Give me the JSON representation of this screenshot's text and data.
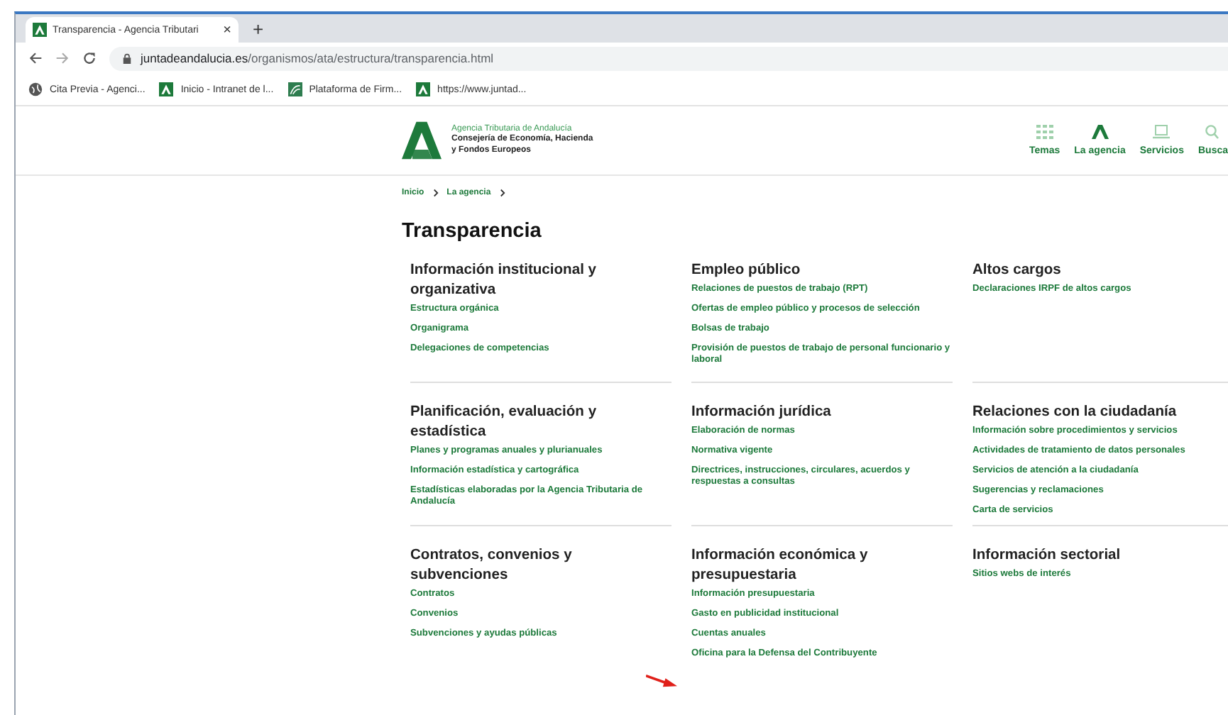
{
  "browser": {
    "tab": {
      "title": "Transparencia - Agencia Tributari",
      "close": "×"
    },
    "new_tab": "+",
    "url": {
      "domain": "juntadeandalucia.es",
      "path": "/organismos/ata/estructura/transparencia.html"
    },
    "bookmarks": [
      {
        "label": "Cita Previa - Agenci...",
        "kind": "globe"
      },
      {
        "label": "Inicio - Intranet de l...",
        "kind": "junta"
      },
      {
        "label": "Plataforma de Firm...",
        "kind": "firma"
      },
      {
        "label": "https://www.juntad...",
        "kind": "junta"
      }
    ]
  },
  "header": {
    "agency": "Agencia Tributaria de Andalucía",
    "ministry": "Consejería de Economía, Hacienda y Fondos Europeos",
    "nav": [
      {
        "label": "Temas",
        "kind": "grid",
        "selected": false
      },
      {
        "label": "La agencia",
        "kind": "logo",
        "selected": true
      },
      {
        "label": "Servicios",
        "kind": "laptop",
        "selected": false
      },
      {
        "label": "Busca",
        "kind": "search",
        "selected": false
      }
    ]
  },
  "breadcrumb": [
    "Inicio",
    "La agencia"
  ],
  "title": "Transparencia",
  "sections": [
    {
      "title": "Información institucional y organizativa",
      "links": [
        "Estructura orgánica",
        "Organigrama",
        "Delegaciones de competencias"
      ]
    },
    {
      "title": "Empleo público",
      "links": [
        "Relaciones de puestos de trabajo (RPT)",
        "Ofertas de empleo público y procesos de selección",
        "Bolsas de trabajo",
        "Provisión de puestos de trabajo de personal funcionario y laboral"
      ]
    },
    {
      "title": "Altos cargos",
      "links": [
        "Declaraciones IRPF de altos cargos"
      ]
    },
    {
      "title": "Planificación, evaluación y estadística",
      "links": [
        "Planes y programas anuales y plurianuales",
        "Información estadística y cartográfica",
        "Estadísticas elaboradas por la Agencia Tributaria de Andalucía"
      ]
    },
    {
      "title": "Información jurídica",
      "links": [
        "Elaboración de normas",
        "Normativa vigente",
        "Directrices, instrucciones, circulares, acuerdos y respuestas a consultas"
      ]
    },
    {
      "title": "Relaciones con la ciudadanía",
      "links": [
        "Información sobre procedimientos y servicios",
        "Actividades de tratamiento de datos personales",
        "Servicios de atención a la ciudadanía",
        "Sugerencias y reclamaciones",
        "Carta de servicios"
      ]
    },
    {
      "title": "Contratos, convenios y subvenciones",
      "links": [
        "Contratos",
        "Convenios",
        "Subvenciones y ayudas públicas"
      ]
    },
    {
      "title": "Información económica y presupuestaria",
      "links": [
        "Información presupuestaria",
        "Gasto en publicidad institucional",
        "Cuentas anuales",
        "Oficina para la Defensa del Contribuyente"
      ]
    },
    {
      "title": "Información sectorial",
      "links": [
        "Sitios webs de interés"
      ]
    }
  ]
}
